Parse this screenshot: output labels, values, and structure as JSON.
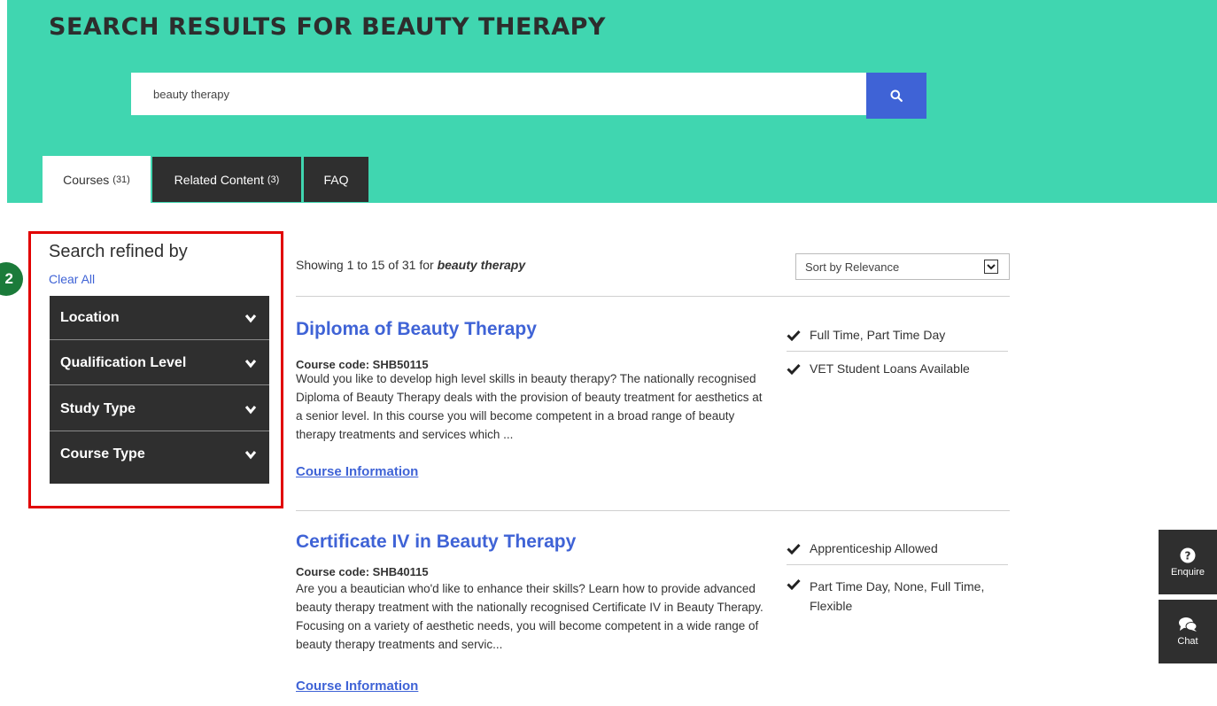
{
  "header": {
    "title": "SEARCH RESULTS FOR BEAUTY THERAPY",
    "search_value": "beauty therapy",
    "search_icon": "search-icon"
  },
  "tabs": [
    {
      "label": "Courses",
      "count": "(31)",
      "active": true
    },
    {
      "label": "Related Content",
      "count": "(3)",
      "active": false
    },
    {
      "label": "FAQ",
      "count": "",
      "active": false
    }
  ],
  "annotation": {
    "badge": "2",
    "color": "#e10000",
    "badge_color": "#1b7b3a"
  },
  "sidebar": {
    "title": "Search refined by",
    "clear_all": "Clear All",
    "filters": [
      {
        "label": "Location"
      },
      {
        "label": "Qualification Level"
      },
      {
        "label": "Study Type"
      },
      {
        "label": "Course Type"
      }
    ]
  },
  "results": {
    "showing_prefix": "Showing 1 to 15 of 31 for ",
    "query": "beauty therapy",
    "sort_label": "Sort by Relevance",
    "courses": [
      {
        "title": "Diploma of Beauty Therapy",
        "code": "Course code: SHB50115",
        "description": "Would you like to develop high level skills in beauty therapy? The nationally recognised Diploma of Beauty Therapy deals with the provision of beauty treatment for aesthetics at a senior level. In this course you will become competent in a broad range of beauty therapy treatments and services which ...",
        "link": "Course Information",
        "features": [
          "Full Time, Part Time Day",
          "VET Student Loans Available"
        ]
      },
      {
        "title": "Certificate IV in Beauty Therapy",
        "code": "Course code: SHB40115",
        "description": "Are you a beautician who'd like to enhance their skills? Learn how to provide advanced beauty therapy treatment with the nationally recognised Certificate IV in Beauty Therapy. Focusing on a variety of aesthetic needs, you will become competent in a wide range of beauty therapy treatments and servic...",
        "link": "Course Information",
        "features": [
          "Apprenticeship Allowed",
          "Part Time Day, None, Full Time, Flexible"
        ]
      }
    ]
  },
  "side_buttons": [
    {
      "label": "Enquire",
      "icon": "question-circle-icon"
    },
    {
      "label": "Chat",
      "icon": "chat-bubbles-icon"
    }
  ],
  "colors": {
    "hero": "#40d6b0",
    "accent": "#3f63d6",
    "dark": "#2f2f2f"
  }
}
